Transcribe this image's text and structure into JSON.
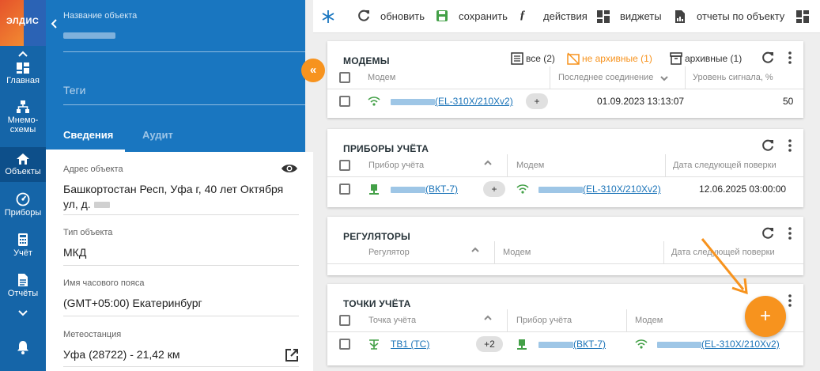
{
  "colors": {
    "nav": "#1565a8",
    "header": "#1976c0",
    "accent": "#f7931e",
    "link": "#1a73b8",
    "signal": "#43a047"
  },
  "logo": {
    "text": "ЭЛДИС"
  },
  "nav": {
    "items": [
      {
        "label": "Главная",
        "icon": "dashboard-icon"
      },
      {
        "label": "Мнемо-",
        "label2": "схемы",
        "icon": "hierarchy-icon"
      },
      {
        "label": "Объекты",
        "icon": "home-icon"
      },
      {
        "label": "Приборы",
        "icon": "gauge-icon"
      },
      {
        "label": "Учёт",
        "icon": "calculator-icon"
      },
      {
        "label": "Отчёты",
        "icon": "document-icon"
      }
    ],
    "bell_icon": "bell-icon"
  },
  "object": {
    "name_label": "Название объекта",
    "tags_placeholder": "Теги",
    "tabs": [
      "Сведения",
      "Аудит"
    ],
    "fields": [
      {
        "label": "Адрес объекта",
        "value": "Башкортостан Респ, Уфа г, 40 лет Октября",
        "value2": "ул, д."
      },
      {
        "label": "Тип объекта",
        "value": "МКД"
      },
      {
        "label": "Имя часового пояса",
        "value": "(GMT+05:00) Екатеринбург"
      },
      {
        "label": "Метеостанция",
        "value": "Уфа (28722) - 21,42 км"
      }
    ]
  },
  "toolbar": {
    "refresh": "обновить",
    "save": "сохранить",
    "actions": "действия",
    "widgets": "виджеты",
    "reports": "отчеты по объекту"
  },
  "modems": {
    "title": "МОДЕМЫ",
    "filters": {
      "all": "все (2)",
      "not_archived": "не архивные (1)",
      "archived": "архивные (1)"
    },
    "columns": [
      "Модем",
      "Последнее соединение",
      "Уровень сигнала, %"
    ],
    "rows": [
      {
        "modem": "(EL-310X/210Xv2)",
        "chip": "+",
        "last": "01.09.2023 13:13:07",
        "signal": "50"
      }
    ]
  },
  "meters": {
    "title": "ПРИБОРЫ УЧЁТА",
    "columns": [
      "Прибор учёта",
      "Модем",
      "Дата следующей поверки"
    ],
    "rows": [
      {
        "device": "(ВКТ-7)",
        "chip": "+",
        "modem": "(EL-310X/210Xv2)",
        "date": "12.06.2025 03:00:00"
      }
    ]
  },
  "regulators": {
    "title": "РЕГУЛЯТОРЫ",
    "columns": [
      "Регулятор",
      "Модем",
      "Дата следующей поверки"
    ]
  },
  "points": {
    "title": "ТОЧКИ УЧЁТА",
    "columns": [
      "Точка учёта",
      "Прибор учёта",
      "Модем"
    ],
    "rows": [
      {
        "point": "ТВ1 (ТС)",
        "chip": "+2",
        "device": "(ВКТ-7)",
        "modem": "(EL-310X/210Xv2)"
      }
    ]
  },
  "fab": {
    "add": "+",
    "collapse": "«"
  }
}
